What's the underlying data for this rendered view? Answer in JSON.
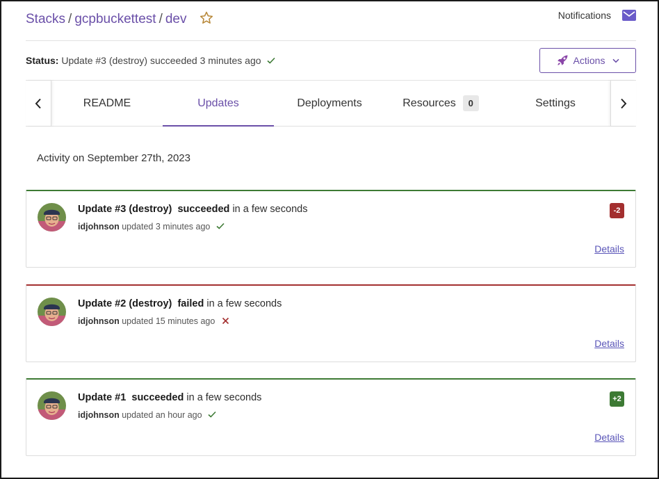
{
  "breadcrumb": {
    "items": [
      "Stacks",
      "gcpbuckettest",
      "dev"
    ],
    "separator": "/"
  },
  "header": {
    "notifications_label": "Notifications"
  },
  "status": {
    "label": "Status:",
    "text": "Update #3 (destroy) succeeded 3 minutes ago"
  },
  "actions": {
    "label": "Actions"
  },
  "tabs": [
    {
      "label": "README"
    },
    {
      "label": "Updates",
      "active": true
    },
    {
      "label": "Deployments"
    },
    {
      "label": "Resources",
      "count": "0"
    },
    {
      "label": "Settings"
    }
  ],
  "activity": {
    "date_heading": "Activity on September 27th, 2023",
    "updates": [
      {
        "title": "Update #3 (destroy)",
        "result": "succeeded",
        "duration": "in a few seconds",
        "user": "idjohnson",
        "updated_text": "updated 3 minutes ago",
        "status": "success",
        "delta": "-2",
        "details_label": "Details"
      },
      {
        "title": "Update #2 (destroy)",
        "result": "failed",
        "duration": "in a few seconds",
        "user": "idjohnson",
        "updated_text": "updated 15 minutes ago",
        "status": "failed",
        "delta": "",
        "details_label": "Details"
      },
      {
        "title": "Update #1",
        "result": "succeeded",
        "duration": "in a few seconds",
        "user": "idjohnson",
        "updated_text": "updated an hour ago",
        "status": "success",
        "delta": "+2",
        "details_label": "Details"
      }
    ]
  },
  "colors": {
    "accent": "#6a4fa8",
    "success": "#3d7a34",
    "failure": "#a32f2f",
    "link": "#5a55b8"
  },
  "icons": {
    "star": "star-icon",
    "mail": "mail-icon",
    "rocket": "rocket-icon",
    "check": "check-icon",
    "cross": "x-icon",
    "chevron_left": "chevron-left-icon",
    "chevron_right": "chevron-right-icon",
    "chevron_down": "chevron-down-icon"
  }
}
